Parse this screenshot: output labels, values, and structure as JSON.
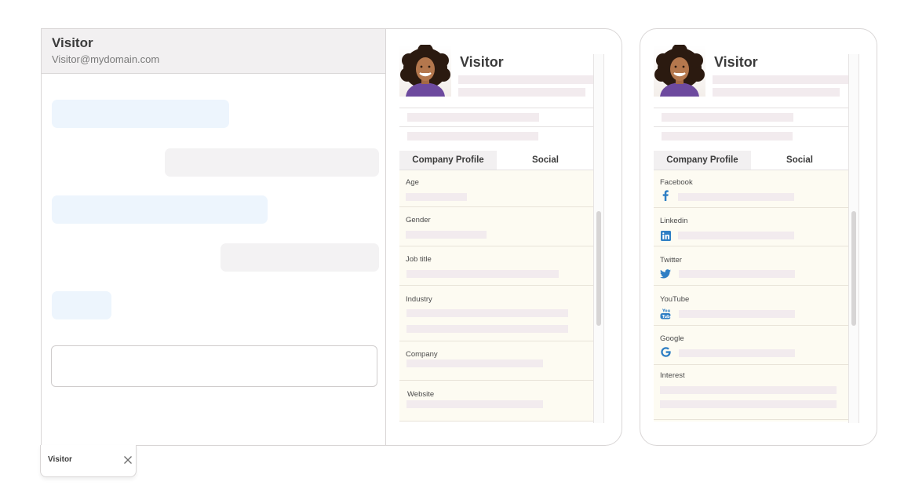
{
  "chat": {
    "visitor_name": "Visitor",
    "visitor_email": "Visitor@mydomain.com",
    "input_placeholder": ""
  },
  "minimized_tab": {
    "label": "Visitor"
  },
  "panel_company": {
    "name": "Visitor",
    "tabs": [
      {
        "label": "Company Profile",
        "active": true
      },
      {
        "label": "Social",
        "active": false
      }
    ],
    "fields": [
      "Age",
      "Gender",
      "Job title",
      "Industry",
      "Company",
      "Website"
    ]
  },
  "panel_social": {
    "name": "Visitor",
    "tabs": [
      {
        "label": "Company Profile",
        "active": true
      },
      {
        "label": "Social",
        "active": false
      }
    ],
    "fields": [
      {
        "label": "Facebook",
        "icon": "facebook-icon"
      },
      {
        "label": "Linkedin",
        "icon": "linkedin-icon"
      },
      {
        "label": "Twitter",
        "icon": "twitter-icon"
      },
      {
        "label": "YouTube",
        "icon": "youtube-icon"
      },
      {
        "label": "Google",
        "icon": "google-icon"
      },
      {
        "label": "Interest",
        "icon": ""
      }
    ]
  },
  "colors": {
    "bubble_incoming": "#edf5fd",
    "bubble_outgoing": "#f3f2f3",
    "field_background": "#fdfbf2",
    "social_blue": "#2f7fc4"
  }
}
